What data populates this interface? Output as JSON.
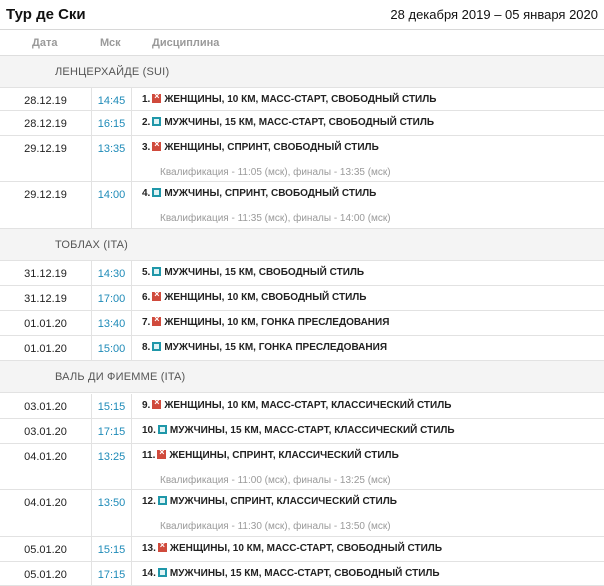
{
  "header": {
    "title": "Тур де Ски",
    "dates": "28 декабря 2019 – 05 января 2020"
  },
  "columns": {
    "date": "Дата",
    "time": "Мск",
    "discipline": "Дисциплина"
  },
  "venues": [
    "ЛЕНЦЕРХАЙДЕ (SUI)",
    "ТОБЛАХ (ITA)",
    "ВАЛЬ ДИ ФИЕММЕ (ITA)"
  ],
  "icons": {
    "women": "women-gender-icon",
    "men": "men-gender-icon"
  },
  "colors": {
    "time": "#1f8bb8",
    "women": "#d04a3c",
    "men": "#1f97a9"
  },
  "races": [
    {
      "date": "28.12.19",
      "time": "14:45",
      "num": "1.",
      "gender": "women",
      "name": "ЖЕНЩИНЫ, 10 КМ, МАСС-СТАРТ, СВОБОДНЫЙ СТИЛЬ",
      "qual": ""
    },
    {
      "date": "28.12.19",
      "time": "16:15",
      "num": "2.",
      "gender": "men",
      "name": "МУЖЧИНЫ, 15 КМ, МАСС-СТАРТ, СВОБОДНЫЙ СТИЛЬ",
      "qual": ""
    },
    {
      "date": "29.12.19",
      "time": "13:35",
      "num": "3.",
      "gender": "women",
      "name": "ЖЕНЩИНЫ, СПРИНТ, СВОБОДНЫЙ СТИЛЬ",
      "qual": "Квалификация - 11:05 (мск), финалы - 13:35 (мск)"
    },
    {
      "date": "29.12.19",
      "time": "14:00",
      "num": "4.",
      "gender": "men",
      "name": "МУЖЧИНЫ, СПРИНТ, СВОБОДНЫЙ СТИЛЬ",
      "qual": "Квалификация - 11:35 (мск), финалы - 14:00 (мск)"
    },
    {
      "date": "31.12.19",
      "time": "14:30",
      "num": "5.",
      "gender": "men",
      "name": "МУЖЧИНЫ, 15 КМ, СВОБОДНЫЙ СТИЛЬ",
      "qual": ""
    },
    {
      "date": "31.12.19",
      "time": "17:00",
      "num": "6.",
      "gender": "women",
      "name": "ЖЕНЩИНЫ, 10 КМ, СВОБОДНЫЙ СТИЛЬ",
      "qual": ""
    },
    {
      "date": "01.01.20",
      "time": "13:40",
      "num": "7.",
      "gender": "women",
      "name": "ЖЕНЩИНЫ, 10 КМ, ГОНКА ПРЕСЛЕДОВАНИЯ",
      "qual": ""
    },
    {
      "date": "01.01.20",
      "time": "15:00",
      "num": "8.",
      "gender": "men",
      "name": "МУЖЧИНЫ, 15 КМ, ГОНКА ПРЕСЛЕДОВАНИЯ",
      "qual": ""
    },
    {
      "date": "03.01.20",
      "time": "15:15",
      "num": "9.",
      "gender": "women",
      "name": "ЖЕНЩИНЫ, 10 КМ, МАСС-СТАРТ, КЛАССИЧЕСКИЙ СТИЛЬ",
      "qual": ""
    },
    {
      "date": "03.01.20",
      "time": "17:15",
      "num": "10.",
      "gender": "men",
      "name": "МУЖЧИНЫ, 15 КМ, МАСС-СТАРТ, КЛАССИЧЕСКИЙ СТИЛЬ",
      "qual": ""
    },
    {
      "date": "04.01.20",
      "time": "13:25",
      "num": "11.",
      "gender": "women",
      "name": "ЖЕНЩИНЫ, СПРИНТ, КЛАССИЧЕСКИЙ СТИЛЬ",
      "qual": "Квалификация - 11:00 (мск), финалы - 13:25 (мск)"
    },
    {
      "date": "04.01.20",
      "time": "13:50",
      "num": "12.",
      "gender": "men",
      "name": "МУЖЧИНЫ, СПРИНТ, КЛАССИЧЕСКИЙ СТИЛЬ",
      "qual": "Квалификация - 11:30 (мск), финалы - 13:50 (мск)"
    },
    {
      "date": "05.01.20",
      "time": "15:15",
      "num": "13.",
      "gender": "women",
      "name": "ЖЕНЩИНЫ, 10 КМ, МАСС-СТАРТ, СВОБОДНЫЙ СТИЛЬ",
      "qual": ""
    },
    {
      "date": "05.01.20",
      "time": "17:15",
      "num": "14.",
      "gender": "men",
      "name": "МУЖЧИНЫ, 15 КМ, МАСС-СТАРТ, СВОБОДНЫЙ СТИЛЬ",
      "qual": ""
    }
  ]
}
